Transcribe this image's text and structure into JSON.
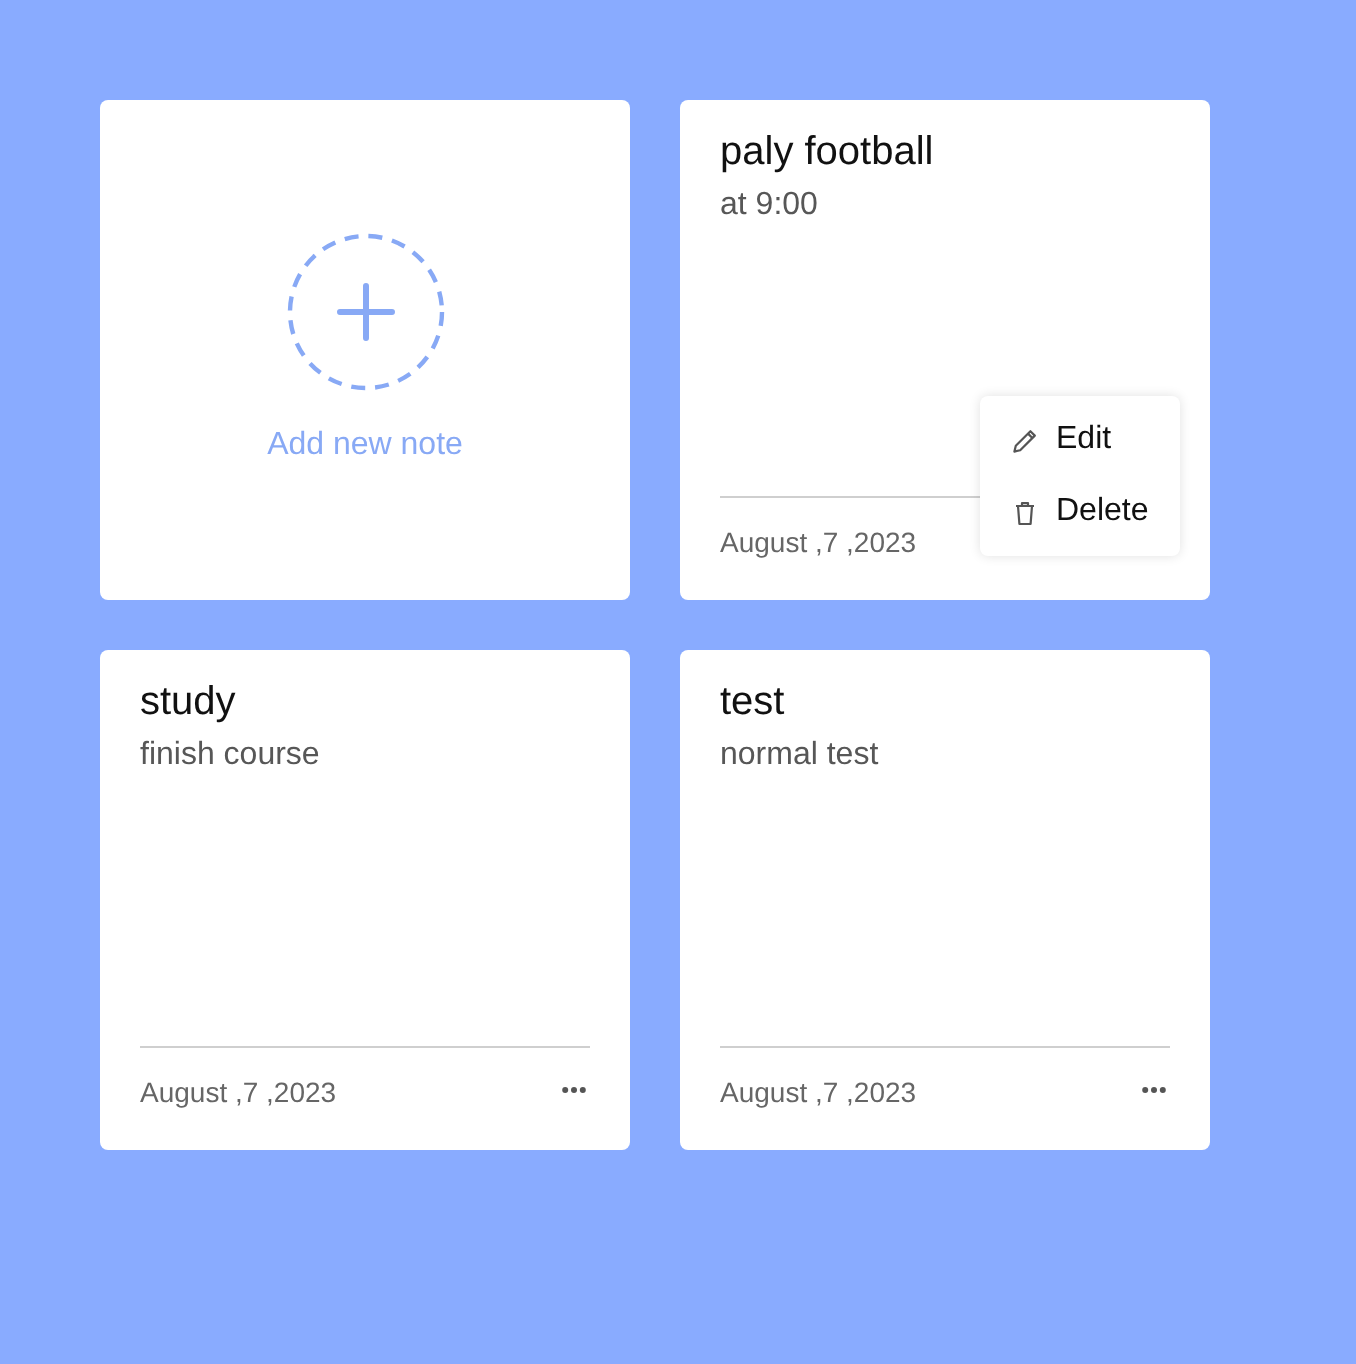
{
  "add_card": {
    "label": "Add new note"
  },
  "notes": [
    {
      "title": "paly football",
      "description": "at 9:00",
      "date": "August ,7 ,2023",
      "menu_open": true
    },
    {
      "title": "study",
      "description": "finish course",
      "date": "August ,7 ,2023",
      "menu_open": false
    },
    {
      "title": "test",
      "description": "normal test",
      "date": "August ,7 ,2023",
      "menu_open": false
    }
  ],
  "menu": {
    "items": [
      {
        "kind": "edit",
        "label": "Edit"
      },
      {
        "kind": "delete",
        "label": "Delete"
      }
    ]
  }
}
